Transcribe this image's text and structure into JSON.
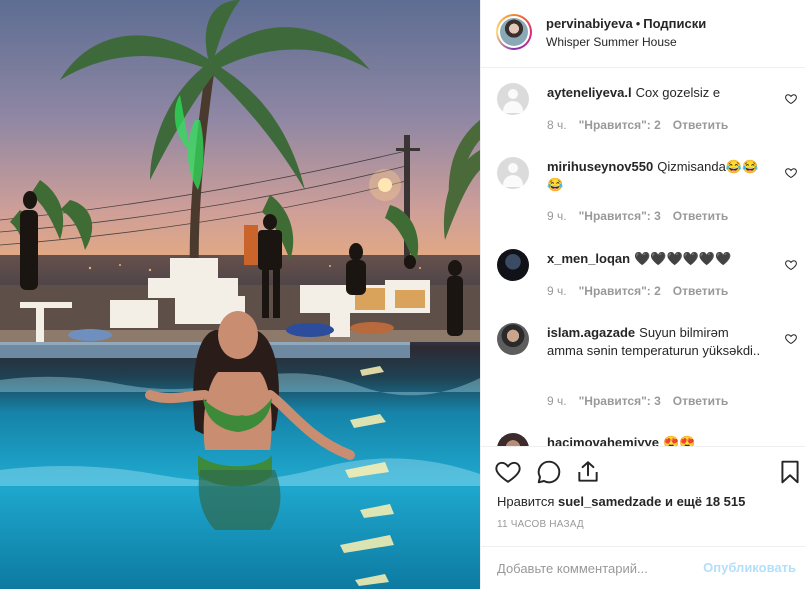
{
  "post": {
    "username": "pervinabiyeva",
    "separator": "•",
    "follow_label": "Подписки",
    "location": "Whisper Summer House"
  },
  "comments": [
    {
      "username": "ayteneliyeva.l",
      "text": "Cox gozelsiz e",
      "time": "8 ч.",
      "likes": "\"Нравится\": 2",
      "reply": "Ответить",
      "avatar": "blank"
    },
    {
      "username": "mirihuseynov550",
      "text": "Qizmisanda😂😂😂",
      "time": "9 ч.",
      "likes": "\"Нравится\": 3",
      "reply": "Ответить",
      "avatar": "blank"
    },
    {
      "username": "x_men_loqan",
      "text": "🖤🖤🖤🖤🖤🖤",
      "time": "9 ч.",
      "likes": "\"Нравится\": 2",
      "reply": "Ответить",
      "avatar": "dark"
    },
    {
      "username": "islam.agazade",
      "text": "Suyun bilmirəm amma sənin temperaturun yüksəkdi..",
      "time": "9 ч.",
      "likes": "\"Нравится\": 3",
      "reply": "Ответить",
      "avatar": "photo"
    },
    {
      "username": "hacimovahemiyye",
      "text": "😍😍",
      "avatar": "photo"
    }
  ],
  "actions": {
    "like_icon": "heart-icon",
    "comment_icon": "comment-icon",
    "share_icon": "share-icon",
    "save_icon": "bookmark-icon",
    "likes_prefix": "Нравится",
    "liker": "suel_samedzade",
    "likes_suffix": "и ещё 18 515",
    "timestamp": "11 ЧАСОВ НАЗАД"
  },
  "add_comment": {
    "placeholder": "Добавьте комментарий...",
    "publish_label": "Опубликовать"
  },
  "colors": {
    "text": "#262626",
    "muted": "#999999",
    "publish_disabled": "#b2dffc",
    "border": "#efefef"
  }
}
